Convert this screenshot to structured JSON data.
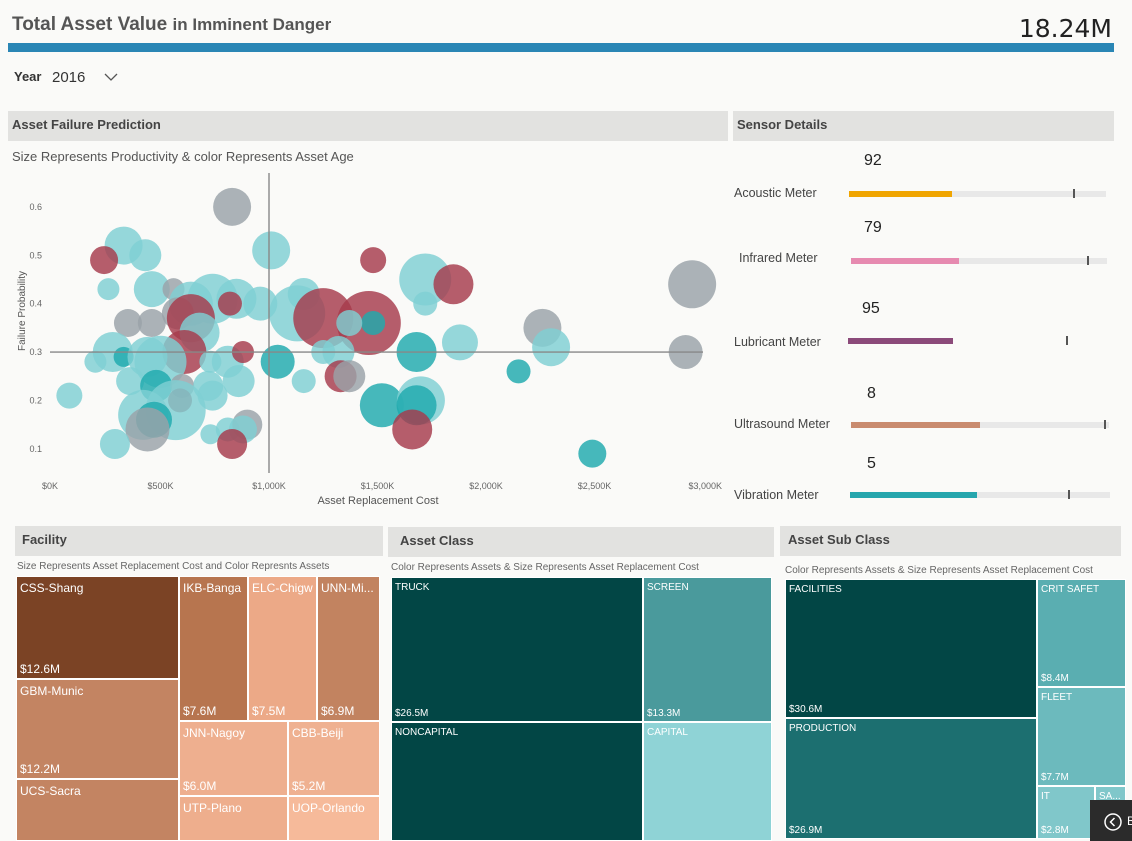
{
  "header": {
    "title_main": "Total Asset Value",
    "title_rest": "in Imminent Danger",
    "total_value": "18.24M"
  },
  "filter": {
    "year_label": "Year",
    "year_value": "2016"
  },
  "asset_failure": {
    "title": "Asset Failure Prediction",
    "subtitle": "Size Represents Productivity & color Represents Asset Age"
  },
  "chart_data": {
    "type": "scatter",
    "xlabel": "Asset Replacement Cost",
    "ylabel": "Failure Probability",
    "xlim": [
      0,
      3000
    ],
    "ylim": [
      0.05,
      0.67
    ],
    "x_ticks": [
      "$0K",
      "$500K",
      "$1,000K",
      "$1,500K",
      "$2,000K",
      "$2,500K",
      "$3,000K"
    ],
    "y_ticks": [
      "0.1",
      "0.2",
      "0.3",
      "0.4",
      "0.5",
      "0.6"
    ],
    "reference_lines": {
      "x": 1000,
      "y": 0.3
    },
    "colors": {
      "light": "#7fcfd3",
      "teal": "#1fa9ad",
      "gray": "#9aa2a8",
      "maroon": "#a63a4c"
    },
    "points": [
      {
        "x": 830,
        "y": 0.6,
        "r": 19,
        "c": "gray"
      },
      {
        "x": 330,
        "y": 0.52,
        "r": 19,
        "c": "light"
      },
      {
        "x": 430,
        "y": 0.5,
        "r": 16,
        "c": "light"
      },
      {
        "x": 240,
        "y": 0.49,
        "r": 14,
        "c": "maroon"
      },
      {
        "x": 1010,
        "y": 0.51,
        "r": 19,
        "c": "light"
      },
      {
        "x": 1480,
        "y": 0.49,
        "r": 13,
        "c": "maroon"
      },
      {
        "x": 1720,
        "y": 0.45,
        "r": 26,
        "c": "light"
      },
      {
        "x": 1850,
        "y": 0.44,
        "r": 20,
        "c": "maroon"
      },
      {
        "x": 2950,
        "y": 0.44,
        "r": 24,
        "c": "gray"
      },
      {
        "x": 260,
        "y": 0.43,
        "r": 11,
        "c": "light"
      },
      {
        "x": 460,
        "y": 0.43,
        "r": 18,
        "c": "light"
      },
      {
        "x": 560,
        "y": 0.43,
        "r": 11,
        "c": "gray"
      },
      {
        "x": 740,
        "y": 0.41,
        "r": 25,
        "c": "light"
      },
      {
        "x": 850,
        "y": 0.41,
        "r": 20,
        "c": "light"
      },
      {
        "x": 1160,
        "y": 0.42,
        "r": 16,
        "c": "light"
      },
      {
        "x": 640,
        "y": 0.4,
        "r": 22,
        "c": "light"
      },
      {
        "x": 820,
        "y": 0.4,
        "r": 12,
        "c": "maroon"
      },
      {
        "x": 960,
        "y": 0.4,
        "r": 17,
        "c": "light"
      },
      {
        "x": 580,
        "y": 0.38,
        "r": 16,
        "c": "gray"
      },
      {
        "x": 640,
        "y": 0.37,
        "r": 24,
        "c": "maroon"
      },
      {
        "x": 1130,
        "y": 0.38,
        "r": 28,
        "c": "light"
      },
      {
        "x": 1250,
        "y": 0.37,
        "r": 30,
        "c": "maroon"
      },
      {
        "x": 1460,
        "y": 0.36,
        "r": 32,
        "c": "maroon"
      },
      {
        "x": 1480,
        "y": 0.36,
        "r": 12,
        "c": "teal"
      },
      {
        "x": 1370,
        "y": 0.36,
        "r": 13,
        "c": "light"
      },
      {
        "x": 1720,
        "y": 0.4,
        "r": 12,
        "c": "light"
      },
      {
        "x": 1880,
        "y": 0.32,
        "r": 18,
        "c": "light"
      },
      {
        "x": 2260,
        "y": 0.35,
        "r": 19,
        "c": "gray"
      },
      {
        "x": 2300,
        "y": 0.31,
        "r": 19,
        "c": "light"
      },
      {
        "x": 2920,
        "y": 0.3,
        "r": 17,
        "c": "gray"
      },
      {
        "x": 350,
        "y": 0.36,
        "r": 14,
        "c": "gray"
      },
      {
        "x": 460,
        "y": 0.36,
        "r": 14,
        "c": "gray"
      },
      {
        "x": 680,
        "y": 0.34,
        "r": 20,
        "c": "light"
      },
      {
        "x": 610,
        "y": 0.3,
        "r": 22,
        "c": "maroon"
      },
      {
        "x": 280,
        "y": 0.3,
        "r": 20,
        "c": "light"
      },
      {
        "x": 330,
        "y": 0.29,
        "r": 10,
        "c": "teal"
      },
      {
        "x": 440,
        "y": 0.29,
        "r": 20,
        "c": "light"
      },
      {
        "x": 500,
        "y": 0.28,
        "r": 26,
        "c": "light"
      },
      {
        "x": 730,
        "y": 0.28,
        "r": 11,
        "c": "light"
      },
      {
        "x": 810,
        "y": 0.28,
        "r": 16,
        "c": "light"
      },
      {
        "x": 880,
        "y": 0.3,
        "r": 11,
        "c": "maroon"
      },
      {
        "x": 1040,
        "y": 0.28,
        "r": 17,
        "c": "teal"
      },
      {
        "x": 1250,
        "y": 0.3,
        "r": 12,
        "c": "light"
      },
      {
        "x": 1320,
        "y": 0.3,
        "r": 16,
        "c": "light"
      },
      {
        "x": 1680,
        "y": 0.3,
        "r": 20,
        "c": "teal"
      },
      {
        "x": 2150,
        "y": 0.26,
        "r": 12,
        "c": "teal"
      },
      {
        "x": 200,
        "y": 0.28,
        "r": 11,
        "c": "light"
      },
      {
        "x": 360,
        "y": 0.24,
        "r": 14,
        "c": "light"
      },
      {
        "x": 480,
        "y": 0.23,
        "r": 16,
        "c": "teal"
      },
      {
        "x": 600,
        "y": 0.23,
        "r": 12,
        "c": "gray"
      },
      {
        "x": 720,
        "y": 0.23,
        "r": 15,
        "c": "light"
      },
      {
        "x": 860,
        "y": 0.24,
        "r": 16,
        "c": "light"
      },
      {
        "x": 1160,
        "y": 0.24,
        "r": 12,
        "c": "light"
      },
      {
        "x": 1330,
        "y": 0.25,
        "r": 16,
        "c": "maroon"
      },
      {
        "x": 1370,
        "y": 0.25,
        "r": 16,
        "c": "gray"
      },
      {
        "x": 80,
        "y": 0.21,
        "r": 13,
        "c": "light"
      },
      {
        "x": 590,
        "y": 0.2,
        "r": 12,
        "c": "maroon"
      },
      {
        "x": 740,
        "y": 0.21,
        "r": 15,
        "c": "light"
      },
      {
        "x": 420,
        "y": 0.17,
        "r": 25,
        "c": "light"
      },
      {
        "x": 570,
        "y": 0.18,
        "r": 30,
        "c": "light"
      },
      {
        "x": 470,
        "y": 0.16,
        "r": 18,
        "c": "teal"
      },
      {
        "x": 440,
        "y": 0.14,
        "r": 22,
        "c": "gray"
      },
      {
        "x": 810,
        "y": 0.14,
        "r": 12,
        "c": "light"
      },
      {
        "x": 900,
        "y": 0.15,
        "r": 15,
        "c": "gray"
      },
      {
        "x": 880,
        "y": 0.14,
        "r": 14,
        "c": "light"
      },
      {
        "x": 730,
        "y": 0.13,
        "r": 10,
        "c": "light"
      },
      {
        "x": 1520,
        "y": 0.19,
        "r": 22,
        "c": "teal"
      },
      {
        "x": 1700,
        "y": 0.2,
        "r": 24,
        "c": "light"
      },
      {
        "x": 1680,
        "y": 0.19,
        "r": 20,
        "c": "teal"
      },
      {
        "x": 1660,
        "y": 0.14,
        "r": 20,
        "c": "maroon"
      },
      {
        "x": 290,
        "y": 0.11,
        "r": 15,
        "c": "light"
      },
      {
        "x": 830,
        "y": 0.11,
        "r": 15,
        "c": "maroon"
      },
      {
        "x": 2490,
        "y": 0.09,
        "r": 14,
        "c": "teal"
      }
    ]
  },
  "sensor": {
    "title": "Sensor Details",
    "items": [
      {
        "label": "Acoustic Meter",
        "value": "92",
        "fill": 0.4,
        "target": 0.87,
        "color": "#f0a500"
      },
      {
        "label": "Infrared Meter",
        "value": "79",
        "fill": 0.42,
        "target": 0.92,
        "color": "#e68ab0"
      },
      {
        "label": "Lubricant Meter",
        "value": "95",
        "fill": 0.41,
        "target": 0.85,
        "color": "#8b4a7a"
      },
      {
        "label": "Ultrasound Meter",
        "value": "8",
        "fill": 0.5,
        "target": 0.98,
        "color": "#c98b6f"
      },
      {
        "label": "Vibration Meter",
        "value": "5",
        "fill": 0.49,
        "target": 0.84,
        "color": "#26a6ad"
      }
    ]
  },
  "facility": {
    "title": "Facility",
    "subtitle": "Size Represents Asset Replacement Cost and Color Represnts Assets",
    "cells": [
      {
        "label": "CSS-Shang",
        "value": "$12.6M",
        "color": "#7b4325"
      },
      {
        "label": "GBM-Munic",
        "value": "$12.2M",
        "color": "#c38462"
      },
      {
        "label": "UCS-Sacra",
        "value": "",
        "color": "#c38462"
      },
      {
        "label": "IKB-Banga",
        "value": "$7.6M",
        "color": "#b7754f"
      },
      {
        "label": "ELC-Chigw",
        "value": "$7.5M",
        "color": "#eca987"
      },
      {
        "label": "UNN-Mi...",
        "value": "$6.9M",
        "color": "#c28360"
      },
      {
        "label": "JNN-Nagoy",
        "value": "$6.0M",
        "color": "#eeaf8f"
      },
      {
        "label": "CBB-Beiji",
        "value": "$5.2M",
        "color": "#efb191"
      },
      {
        "label": "UTP-Plano",
        "value": "",
        "color": "#eeae8d"
      },
      {
        "label": "UOP-Orlando",
        "value": "",
        "color": "#f6ba9a"
      }
    ]
  },
  "asset_class": {
    "title": "Asset Class",
    "subtitle": "Color Represents Assets & Size Represents Asset Replacement Cost",
    "cells": [
      {
        "label": "TRUCK",
        "value": "$26.5M",
        "color": "#024645"
      },
      {
        "label": "SCREEN",
        "value": "$13.3M",
        "color": "#4a9a9c"
      },
      {
        "label": "NONCAPITAL",
        "value": "",
        "color": "#024645"
      },
      {
        "label": "CAPITAL",
        "value": "",
        "color": "#8fd3d6"
      }
    ]
  },
  "asset_sub_class": {
    "title": "Asset Sub Class",
    "subtitle": "Color Represents Assets & Size Represents Asset Replacement Cost",
    "cells": [
      {
        "label": "FACILITIES",
        "value": "$30.6M",
        "color": "#024645"
      },
      {
        "label": "CRIT SAFET",
        "value": "$8.4M",
        "color": "#5aaeb1"
      },
      {
        "label": "PRODUCTION",
        "value": "$26.9M",
        "color": "#1c6f70"
      },
      {
        "label": "FLEET",
        "value": "$7.7M",
        "color": "#6cbabd"
      },
      {
        "label": "IT",
        "value": "$2.8M",
        "color": "#80c7ca"
      },
      {
        "label": "SA...",
        "value": "",
        "color": "#80c7ca"
      }
    ]
  },
  "nav": {
    "back_label": "B"
  }
}
